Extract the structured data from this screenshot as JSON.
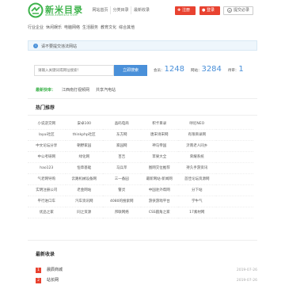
{
  "header": {
    "logo_text": "新米目录",
    "logo_sub": "WWW.XINMILIU.COM",
    "nav": [
      "网站首页",
      "分类目录",
      "最新收录"
    ],
    "register_label": "注册",
    "login_label": "登录",
    "submit_label": "提交必录"
  },
  "categories": [
    "行业企业",
    "休闲娱乐",
    "电脑网络",
    "生活服务",
    "教育文化",
    "综合其他"
  ],
  "notice": "请不要提交违法网站",
  "search": {
    "placeholder": "请输入关键词或网址搜索！",
    "button": "立即搜索"
  },
  "stats": {
    "sites_label": "会员：",
    "sites_value": "1248",
    "domains_label": "网站：",
    "domains_value": "3284",
    "pending_label": "待审：",
    "pending_value": "1"
  },
  "latest": {
    "label": "最新快审：",
    "items": [
      "江西南打视频网",
      "共享汽电站"
    ]
  },
  "hot": {
    "title": "热门推荐",
    "items": [
      "小说逆交网",
      "安卓100",
      "晶码电商",
      "积卡目录",
      "呼尼NEO",
      "",
      "layui社区",
      "thinkphp社区",
      "东方网",
      "唐宋诗宋网",
      "有限目录网",
      "",
      "中文论坛分享",
      "朝野家园",
      "家园网",
      "神马帝国",
      "沂南老人同乡",
      "",
      "中公考研网",
      "绿化网",
      "百吉",
      "苹果大全",
      "荣耀系统",
      "",
      "hao123",
      "恒草基础",
      "马兵萃",
      "图网交位推荐",
      "持久手游资讯",
      "",
      "气老网导购",
      "云路机械设备网",
      "三一备园",
      "最新网站-新闻网",
      "首佳论坛资源网",
      "",
      "实明注册公司",
      "老金网站",
      "警灵",
      "中国驻外帮网",
      "分下站",
      "",
      "平行进口车",
      "汽车资讯网",
      "4080的搜索网",
      "游侠游戏平台",
      "学牛气",
      "",
      "优品之家",
      "同之资源",
      "邦联网络",
      "CSS圆角之家",
      "17素材网",
      ""
    ]
  },
  "recent": {
    "title": "最新收录",
    "items": [
      {
        "num": "1",
        "name": "晨辰商城",
        "date": "2019-07-26"
      },
      {
        "num": "2",
        "name": "站长网",
        "date": "2019-07-26"
      }
    ]
  },
  "colors": {
    "brand": "#3cb24a",
    "accent": "#e84230",
    "link": "#4a90d9"
  }
}
